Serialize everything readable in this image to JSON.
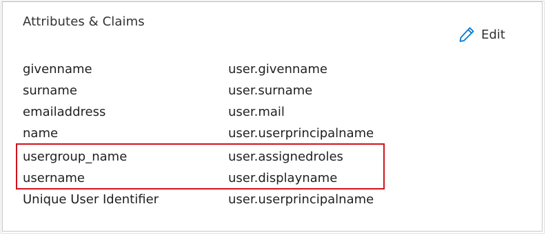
{
  "panel": {
    "title": "Attributes & Claims",
    "edit_label": "Edit",
    "edit_icon": "pencil-icon",
    "accent_color": "#0078d4",
    "highlight_color": "#d0121b"
  },
  "claims": [
    {
      "name": "givenname",
      "value": "user.givenname"
    },
    {
      "name": "surname",
      "value": "user.surname"
    },
    {
      "name": "emailaddress",
      "value": "user.mail"
    },
    {
      "name": "name",
      "value": "user.userprincipalname"
    },
    {
      "name": "usergroup_name",
      "value": "user.assignedroles"
    },
    {
      "name": "username",
      "value": "user.displayname"
    },
    {
      "name": "Unique User Identifier",
      "value": "user.userprincipalname"
    }
  ]
}
